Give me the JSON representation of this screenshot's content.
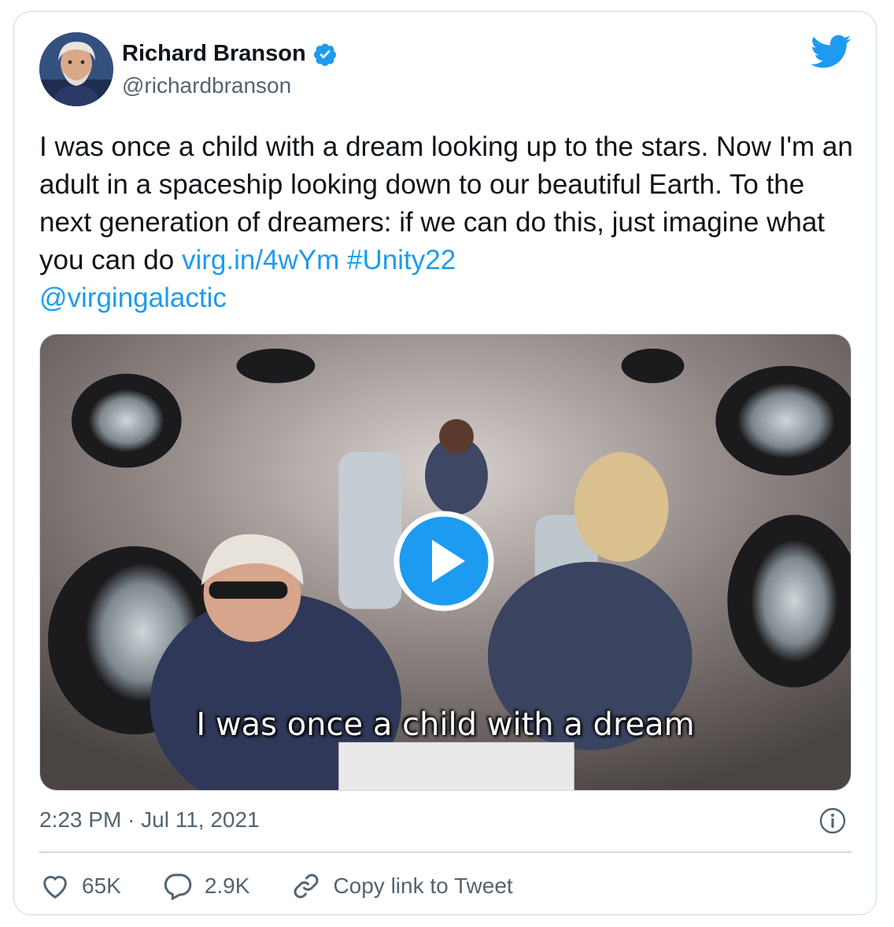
{
  "author": {
    "name": "Richard Branson",
    "handle": "@richardbranson",
    "verified": true
  },
  "tweet": {
    "text_plain": "I was once a child with a dream looking up to the stars. Now I'm an adult in a spaceship looking down to our beautiful Earth. To the next generation of dreamers: if we can do this, just imagine what you can do ",
    "link": "virg.in/4wYm",
    "hashtag": "#Unity22",
    "mention": "@virgingalactic"
  },
  "media": {
    "type": "video",
    "caption_overlay": "I was once a child with a dream"
  },
  "meta": {
    "timestamp": "2:23 PM · Jul 11, 2021"
  },
  "actions": {
    "likes": "65K",
    "replies": "2.9K",
    "copy_link": "Copy link to Tweet"
  },
  "icons": {
    "logo": "twitter-bird-icon",
    "verified": "verified-badge-icon",
    "info": "info-icon",
    "like": "heart-icon",
    "reply": "reply-icon",
    "link": "link-icon",
    "play": "play-icon"
  },
  "colors": {
    "brand": "#1d9bf0",
    "text": "#0f1419",
    "secondary": "#536471",
    "border": "#cfd9de"
  }
}
